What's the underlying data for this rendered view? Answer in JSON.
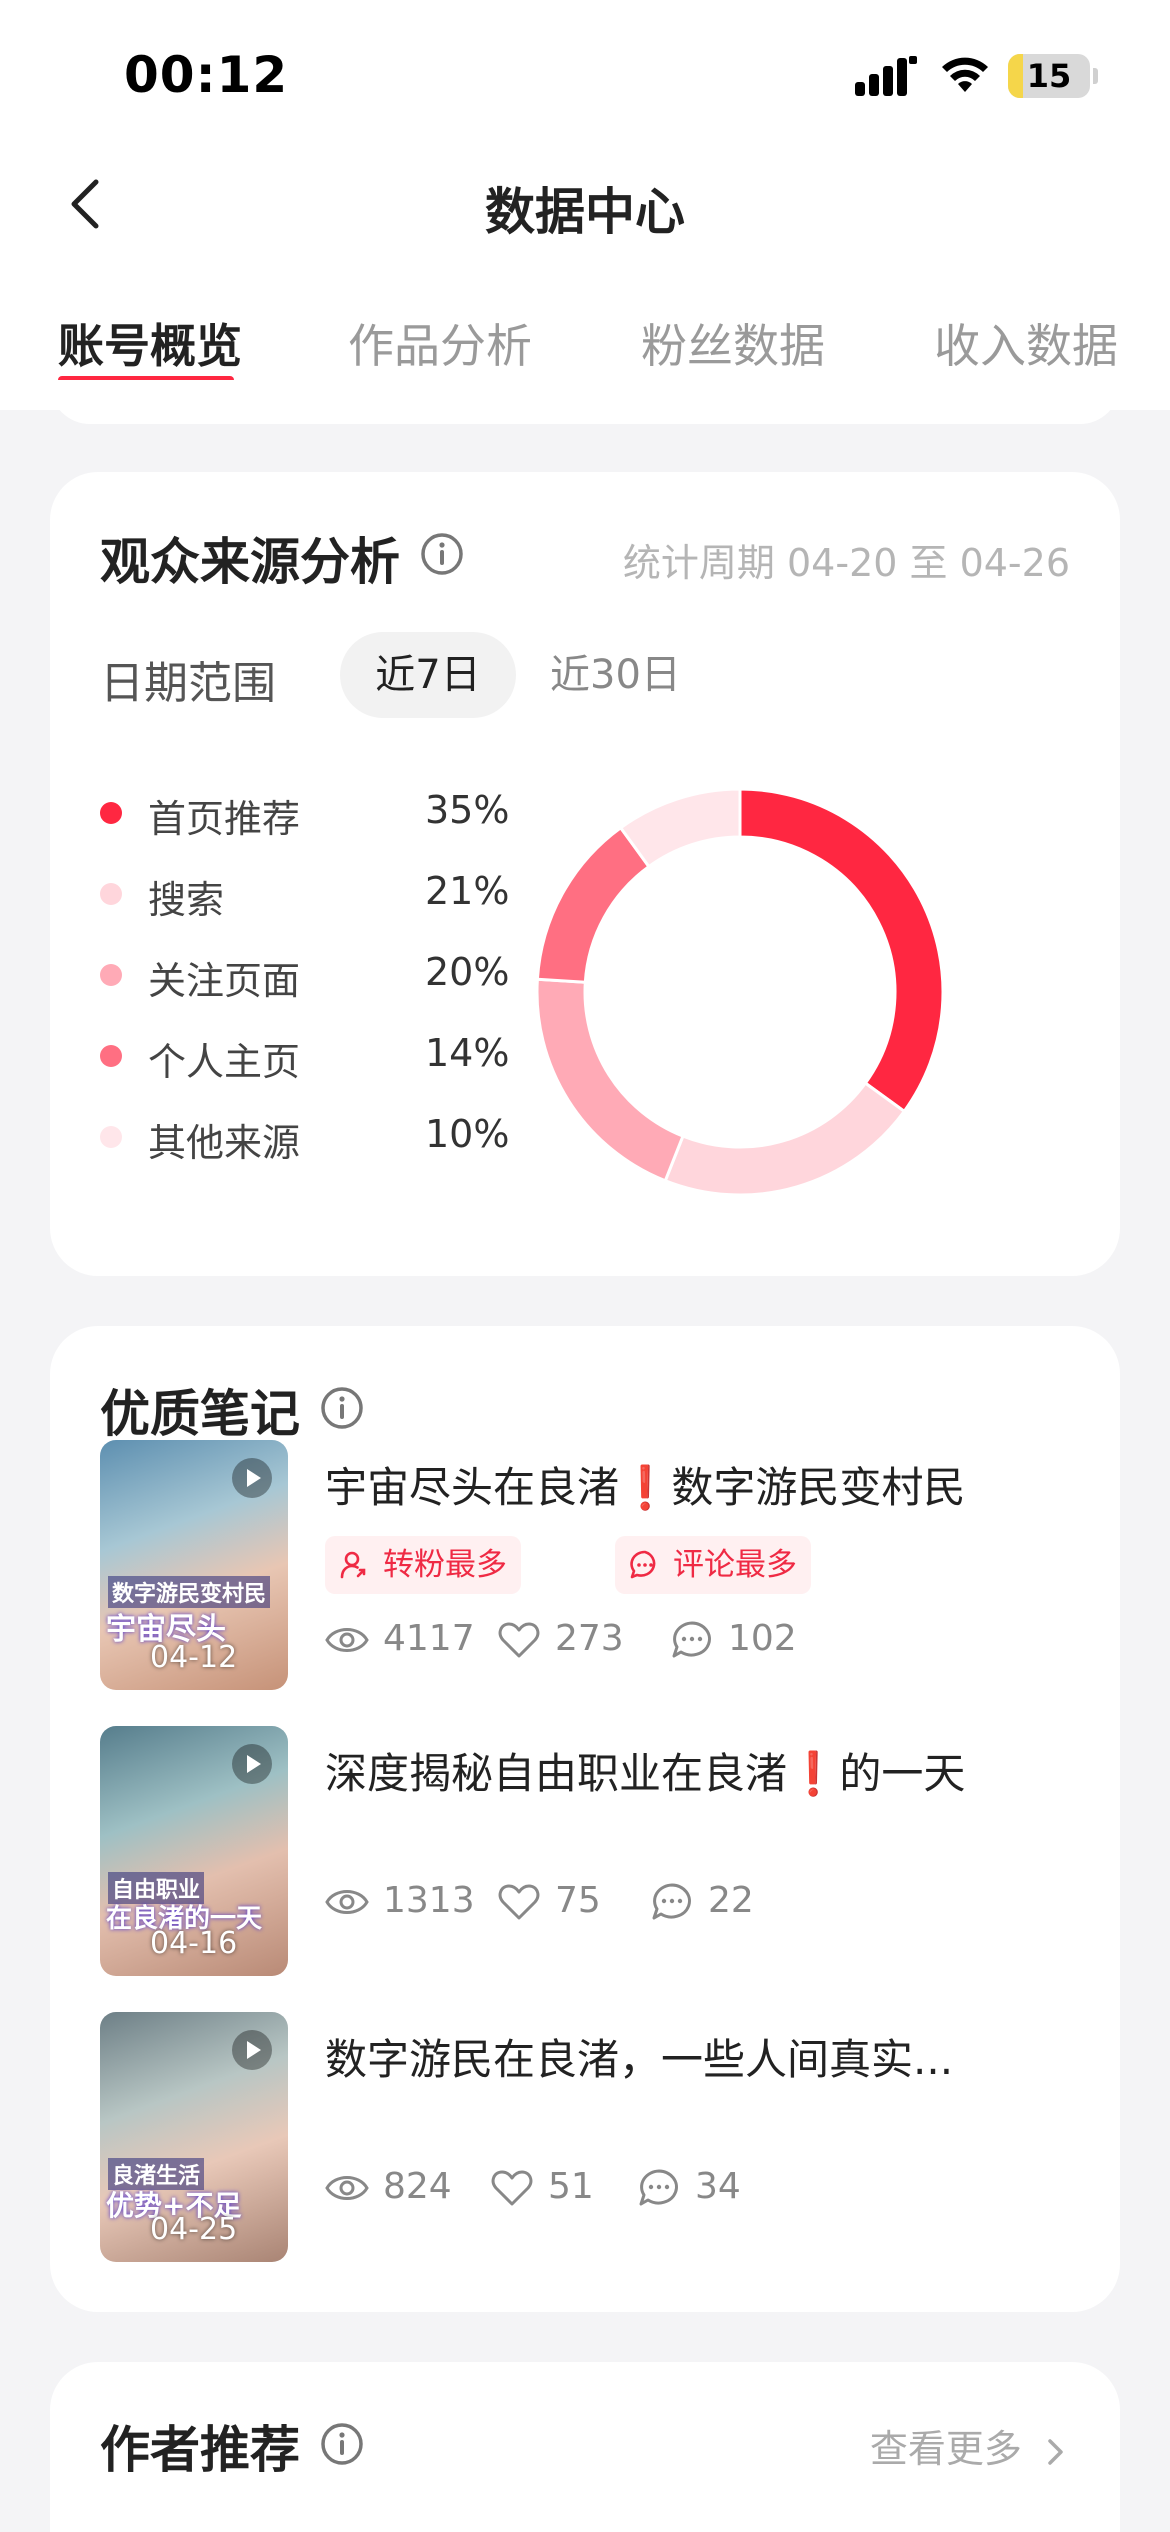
{
  "status_bar": {
    "time": "00:12",
    "battery_level": "15"
  },
  "header": {
    "title": "数据中心",
    "back_icon": "chevron-left-icon"
  },
  "tabs": [
    {
      "label": "账号概览",
      "active": true
    },
    {
      "label": "作品分析",
      "active": false
    },
    {
      "label": "粉丝数据",
      "active": false
    },
    {
      "label": "收入数据",
      "active": false
    }
  ],
  "audience": {
    "title": "观众来源分析",
    "period": "统计周期 04-20 至 04-26",
    "range_label": "日期范围",
    "range_options": [
      "近7日",
      "近30日"
    ],
    "selected_range": "近7日",
    "sources": [
      {
        "label": "首页推荐",
        "value": "35%",
        "percent": 35,
        "color": "#ff2741"
      },
      {
        "label": "搜索",
        "value": "21%",
        "percent": 21,
        "color": "#ffd6dc"
      },
      {
        "label": "关注页面",
        "value": "20%",
        "percent": 20,
        "color": "#ffaab6"
      },
      {
        "label": "个人主页",
        "value": "14%",
        "percent": 14,
        "color": "#ff6f82"
      },
      {
        "label": "其他来源",
        "value": "10%",
        "percent": 10,
        "color": "#ffe6ea"
      }
    ]
  },
  "quality_notes": {
    "title": "优质笔记",
    "items": [
      {
        "title_a": "宇宙尽头在良渚",
        "title_mark": "❗",
        "title_b": "数字游民变村民",
        "date": "04-12",
        "thumb_caption1": "数字游民变村民",
        "thumb_caption2": "宇宙尽头",
        "badges": [
          {
            "label": "转粉最多",
            "icon": "user-growth-icon"
          },
          {
            "label": "评论最多",
            "icon": "comment-icon"
          }
        ],
        "views": "4117",
        "likes": "273",
        "comments": "102"
      },
      {
        "title_a": "深度揭秘自由职业在良渚",
        "title_mark": "❗",
        "title_b": "的一天",
        "date": "04-16",
        "thumb_caption1": "自由职业",
        "thumb_caption2": "在良渚的一天",
        "badges": [],
        "views": "1313",
        "likes": "75",
        "comments": "22"
      },
      {
        "title_a": "数字游民在良渚，一些人间真实...",
        "title_mark": "",
        "title_b": "",
        "date": "04-25",
        "thumb_caption1": "良渚生活",
        "thumb_caption2": "优势+不足",
        "badges": [],
        "views": "824",
        "likes": "51",
        "comments": "34"
      }
    ]
  },
  "authors": {
    "title": "作者推荐",
    "more": "查看更多"
  }
}
